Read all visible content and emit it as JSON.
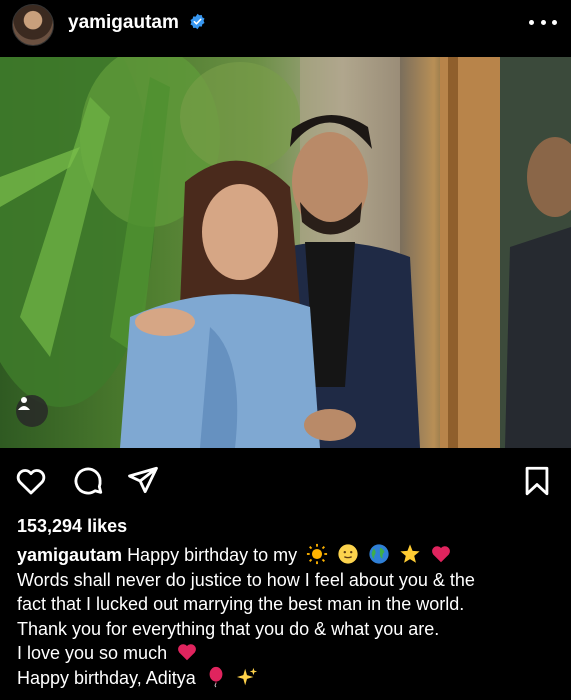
{
  "header": {
    "username": "yamigautam",
    "verified_icon": "verified-badge-icon",
    "more_icon": "more-options-icon"
  },
  "post": {
    "image_alt_icon": "photo",
    "user_tag_icon": "user-tag-icon"
  },
  "actions": {
    "like_icon": "heart-icon",
    "comment_icon": "comment-icon",
    "share_icon": "send-icon",
    "save_icon": "bookmark-icon"
  },
  "likes": "153,294 likes",
  "caption": {
    "username": "yamigautam",
    "line1_text": "Happy birthday to my",
    "line1_emojis": [
      "sun-emoji",
      "smile-face-emoji",
      "globe-emoji",
      "star-emoji",
      "red-heart-emoji"
    ],
    "line2": "Words shall never do justice to how I feel about you & the",
    "line3": "fact that I lucked out marrying the best man in the world.",
    "line4": "Thank you for everything that you do & what you are.",
    "line5_text": "I love you so much",
    "line5_emojis": [
      "red-heart-emoji"
    ],
    "line6_text": "Happy birthday, Aditya",
    "line6_emojis": [
      "balloon-emoji",
      "sparkles-emoji"
    ]
  },
  "colors": {
    "background": "#000000",
    "text": "#ffffff",
    "verified": "#3897f0",
    "heart": "#e0245e"
  }
}
